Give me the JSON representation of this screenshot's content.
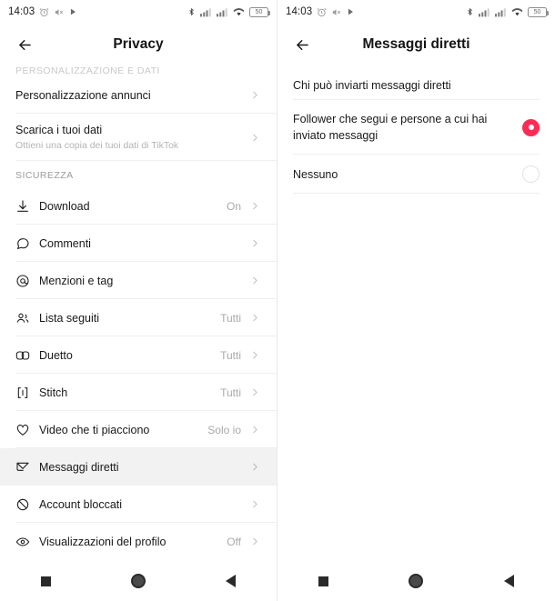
{
  "left": {
    "status": {
      "time": "14:03",
      "icons_left": [
        "alarm-icon",
        "mute-icon",
        "play-icon"
      ],
      "icons_right": [
        "bluetooth-icon",
        "signal-icon",
        "signal2-icon",
        "wifi-icon"
      ],
      "battery_level": "50"
    },
    "header": {
      "back": "back-arrow-icon",
      "title": "Privacy"
    },
    "partial_section": "PERSONALIZZAZIONE E DATI",
    "top_rows": [
      {
        "label": "Personalizzazione annunci",
        "sub": "",
        "value": "",
        "icon": ""
      },
      {
        "label": "Scarica i tuoi dati",
        "sub": "Ottieni una copia dei tuoi dati di TikTok",
        "value": "",
        "icon": ""
      }
    ],
    "section": "SICUREZZA",
    "rows": [
      {
        "label": "Download",
        "value": "On",
        "icon": "download-icon",
        "selected": false
      },
      {
        "label": "Commenti",
        "value": "",
        "icon": "comment-icon",
        "selected": false
      },
      {
        "label": "Menzioni e tag",
        "value": "",
        "icon": "at-icon",
        "selected": false
      },
      {
        "label": "Lista seguiti",
        "value": "Tutti",
        "icon": "people-icon",
        "selected": false
      },
      {
        "label": "Duetto",
        "value": "Tutti",
        "icon": "duet-icon",
        "selected": false
      },
      {
        "label": "Stitch",
        "value": "Tutti",
        "icon": "stitch-icon",
        "selected": false
      },
      {
        "label": "Video che ti piacciono",
        "value": "Solo io",
        "icon": "heart-icon",
        "selected": false
      },
      {
        "label": "Messaggi diretti",
        "value": "",
        "icon": "message-icon",
        "selected": true
      },
      {
        "label": "Account bloccati",
        "value": "",
        "icon": "block-icon",
        "selected": false
      },
      {
        "label": "Visualizzazioni del profilo",
        "value": "Off",
        "icon": "eye-icon",
        "selected": false
      }
    ],
    "nav": [
      "recents-square-icon",
      "home-circle-icon",
      "back-triangle-icon"
    ]
  },
  "right": {
    "status": {
      "time": "14:03",
      "icons_left": [
        "alarm-icon",
        "mute-icon",
        "play-icon"
      ],
      "icons_right": [
        "bluetooth-icon",
        "signal-icon",
        "signal2-icon",
        "wifi-icon"
      ],
      "battery_level": "50"
    },
    "header": {
      "back": "back-arrow-icon",
      "title": "Messaggi diretti"
    },
    "question": "Chi può inviarti messaggi diretti",
    "options": [
      {
        "label": "Follower che segui e persone a cui hai inviato messaggi",
        "selected": true
      },
      {
        "label": "Nessuno",
        "selected": false
      }
    ],
    "nav": [
      "recents-square-icon",
      "home-circle-icon",
      "back-triangle-icon"
    ]
  },
  "colors": {
    "accent": "#fe2c55",
    "text": "#181818",
    "muted": "#a9a9a9",
    "separator": "#efefef",
    "selected_row_bg": "#f2f2f2"
  }
}
